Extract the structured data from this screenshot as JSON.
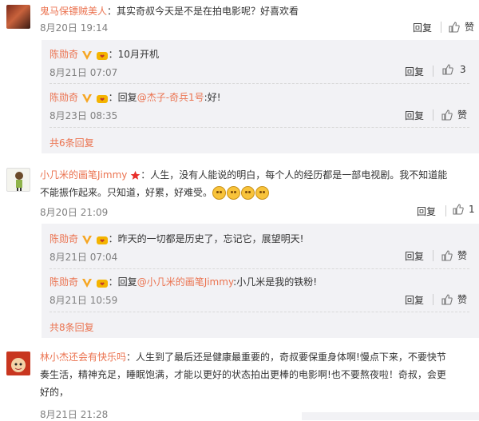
{
  "thread1": {
    "user": "鬼马保镖贼美人",
    "text": "：其实奇叔今天是不是在拍电影呢？好喜欢看",
    "time": "8月20日 19:14",
    "reply_label": "回复",
    "like_label": "赞",
    "replies": [
      {
        "user": "陈勋奇",
        "text": "：10月开机",
        "time": "8月21日 07:07",
        "reply_label": "回复",
        "like_count": "3"
      },
      {
        "user": "陈勋奇",
        "text_prefix": "：回复",
        "mention": "@杰子-奇兵1号",
        "text_suffix": ":好!",
        "time": "8月23日 08:35",
        "reply_label": "回复",
        "like_label": "赞"
      }
    ],
    "more": "共6条回复"
  },
  "thread2": {
    "user": "小几米的画笔Jimmy",
    "text_line1": "：人生，没有人能说的明白，每个人的经历都是一部电视剧。我不知道能",
    "text_line2": "不能振作起来。只知道，好累，好难受。",
    "time": "8月20日 21:09",
    "reply_label": "回复",
    "like_count": "1",
    "replies": [
      {
        "user": "陈勋奇",
        "text": "：昨天的一切都是历史了，忘记它，展望明天!",
        "time": "8月21日 07:04",
        "reply_label": "回复",
        "like_label": "赞"
      },
      {
        "user": "陈勋奇",
        "text_prefix": "：回复",
        "mention": "@小几米的画笔Jimmy",
        "text_suffix": ":小几米是我的铁粉!",
        "time": "8月21日 10:59",
        "reply_label": "回复",
        "like_label": "赞"
      }
    ],
    "more": "共8条回复"
  },
  "thread3": {
    "user": "林小杰还会有快乐吗",
    "text_line1": "：人生到了最后还是健康最重要的，奇叔要保重身体啊!慢点下来，不要快节",
    "text_line2": "奏生活，精神充足，睡眠饱满，才能以更好的状态拍出更棒的电影啊!也不要熬夜啦！奇叔，会更",
    "text_line3": "好的，",
    "time": "8月21日 21:28"
  },
  "colors": {
    "name": "#eb7350",
    "panel": "#f2f2f5",
    "time": "#808080"
  }
}
